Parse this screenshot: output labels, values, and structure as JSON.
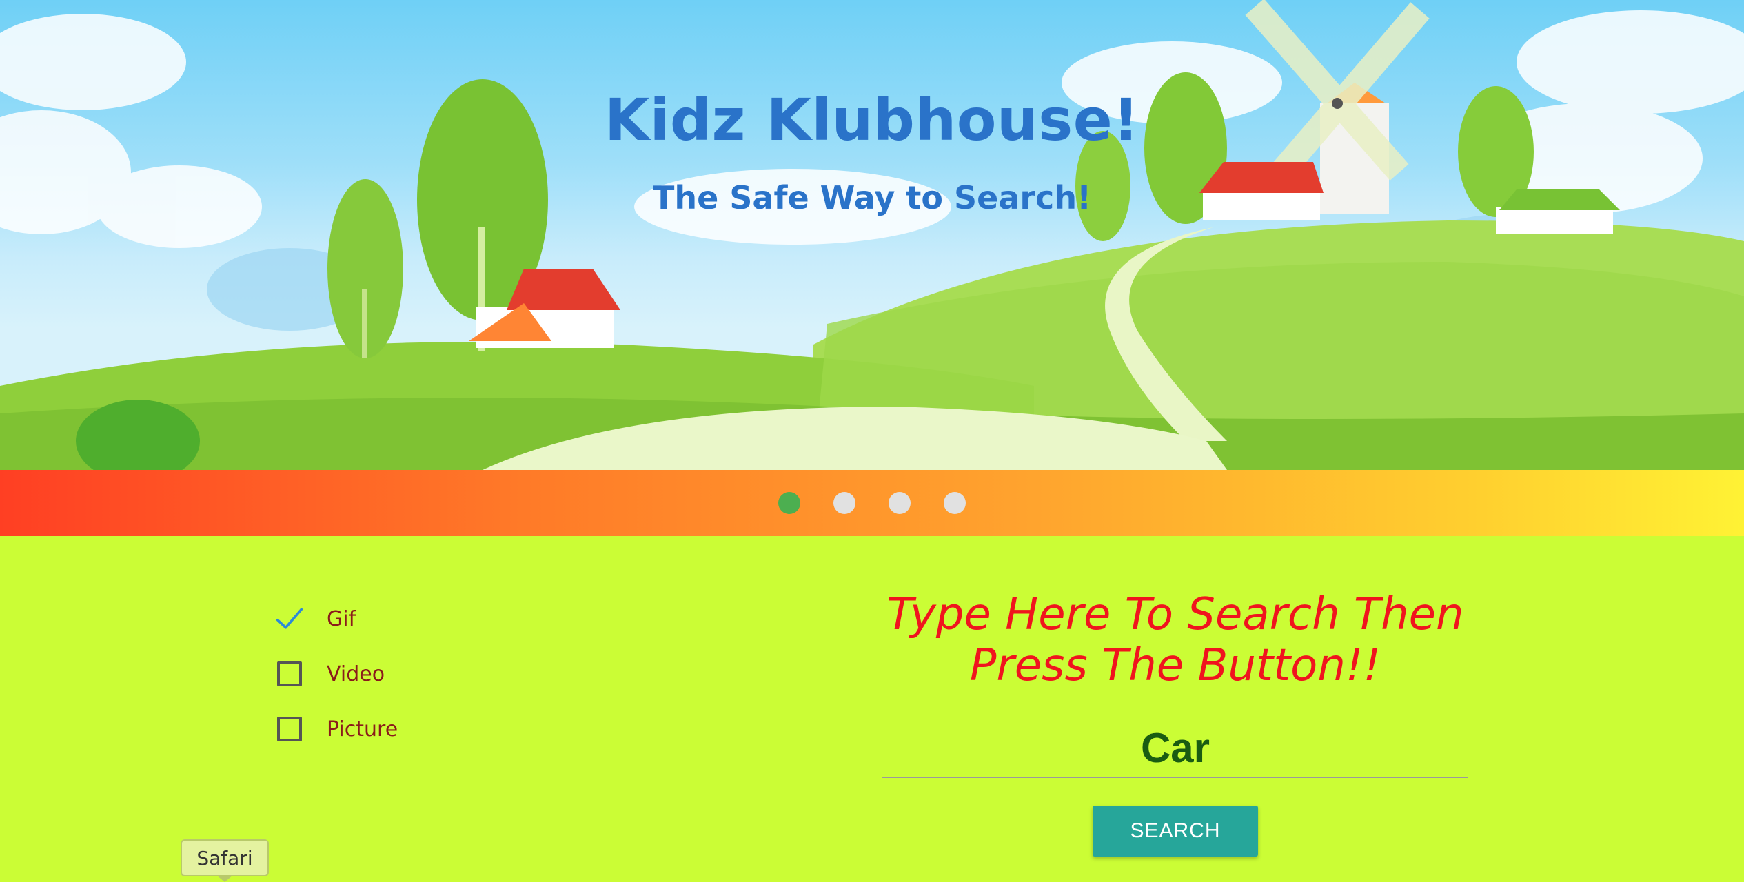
{
  "hero": {
    "title": "Kidz Klubhouse!",
    "subtitle": "The Safe Way to Search!"
  },
  "carousel": {
    "slide_count": 4,
    "active_index": 0,
    "active_color": "#4caf50",
    "inactive_color": "#e1e1e1"
  },
  "options": [
    {
      "label": "Gif",
      "checked": true,
      "icon": "checkmark-icon"
    },
    {
      "label": "Video",
      "checked": false,
      "icon": "checkbox-empty-icon"
    },
    {
      "label": "Picture",
      "checked": false,
      "icon": "checkbox-empty-icon"
    }
  ],
  "search": {
    "prompt_line1": "Type Here To Search Then",
    "prompt_line2": "Press The Button!!",
    "value": "Car",
    "button_label": "SEARCH"
  },
  "tooltip": {
    "label": "Safari"
  },
  "colors": {
    "page_background": "#cbfd35",
    "title": "#2a73c9",
    "prompt": "#f0141e",
    "search_value": "#1a5c12",
    "button": "#26a69a",
    "option_label": "#8a1b1b"
  }
}
